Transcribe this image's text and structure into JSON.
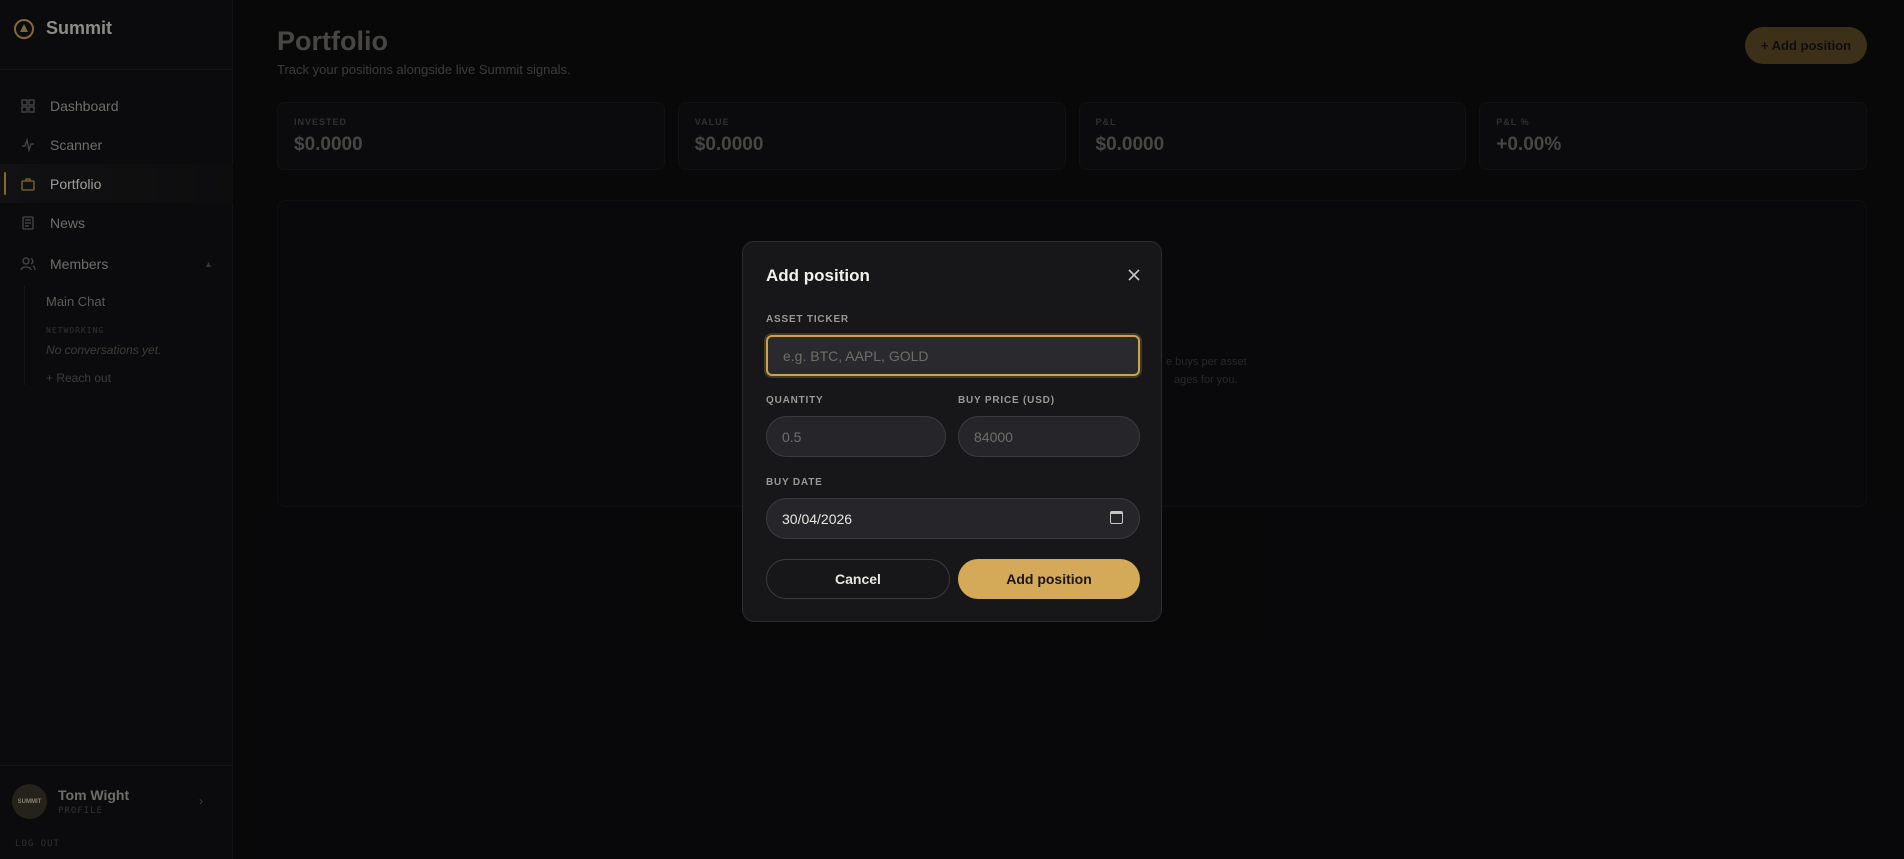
{
  "brand": {
    "name": "Summit"
  },
  "sidebar": {
    "nav": [
      {
        "label": "Dashboard",
        "icon": "grid-icon"
      },
      {
        "label": "Scanner",
        "icon": "pulse-icon"
      },
      {
        "label": "Portfolio",
        "icon": "briefcase-icon",
        "active": true
      },
      {
        "label": "News",
        "icon": "newspaper-icon"
      }
    ],
    "members": {
      "label": "Members",
      "items": [
        {
          "label": "Main Chat"
        }
      ],
      "section_label": "NETWORKING",
      "empty_text": "No conversations yet.",
      "reach_out": "+ Reach out"
    },
    "user": {
      "name": "Tom Wight",
      "role": "PROFILE",
      "avatar_text": "SUMMIT"
    },
    "logout": "LOG OUT"
  },
  "header": {
    "title": "Portfolio",
    "subtitle": "Track your positions alongside live Summit signals.",
    "add_button": "+ Add position"
  },
  "stats": [
    {
      "label": "INVESTED",
      "value": "$0.0000"
    },
    {
      "label": "VALUE",
      "value": "$0.0000"
    },
    {
      "label": "P&L",
      "value": "$0.0000"
    },
    {
      "label": "P&L %",
      "value": "+0.00%"
    }
  ],
  "empty_state": {
    "line1": "e buys per asset",
    "line2": "ages for you."
  },
  "modal": {
    "title": "Add position",
    "ticker": {
      "label": "ASSET TICKER",
      "placeholder": "e.g. BTC, AAPL, GOLD"
    },
    "quantity": {
      "label": "QUANTITY",
      "placeholder": "0.5"
    },
    "price": {
      "label": "BUY PRICE (USD)",
      "placeholder": "84000"
    },
    "date": {
      "label": "BUY DATE",
      "value": "30/04/2026"
    },
    "cancel": "Cancel",
    "submit": "Add position"
  },
  "colors": {
    "accent": "#d4a957",
    "background": "#0d0d0f",
    "panel": "#17171a"
  }
}
